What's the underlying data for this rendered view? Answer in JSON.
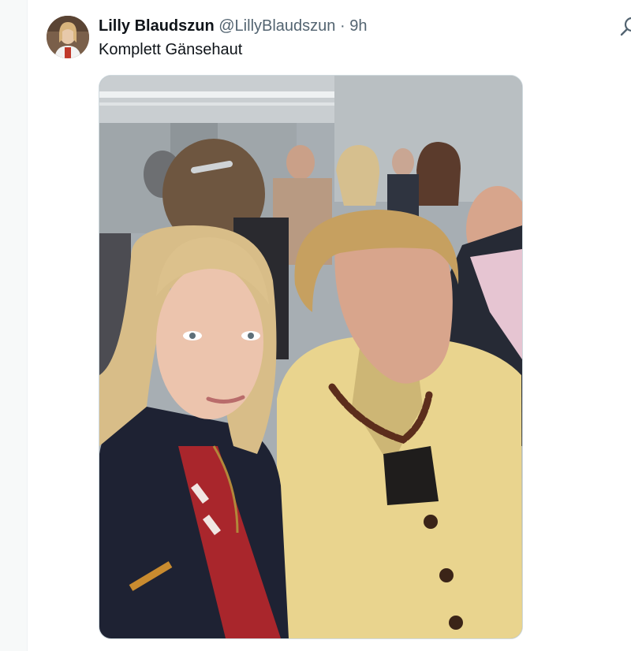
{
  "tweet": {
    "display_name": "Lilly Blaudszun",
    "handle": "@LillyBlaudszun",
    "separator": "·",
    "time": "9h",
    "text": "Komplett Gänsehaut"
  },
  "icons": {
    "avatar": "profile-photo-avatar",
    "corner": "grok-icon"
  },
  "colors": {
    "name": "#0f1419",
    "secondary": "#536471",
    "border": "#cfd9de"
  }
}
